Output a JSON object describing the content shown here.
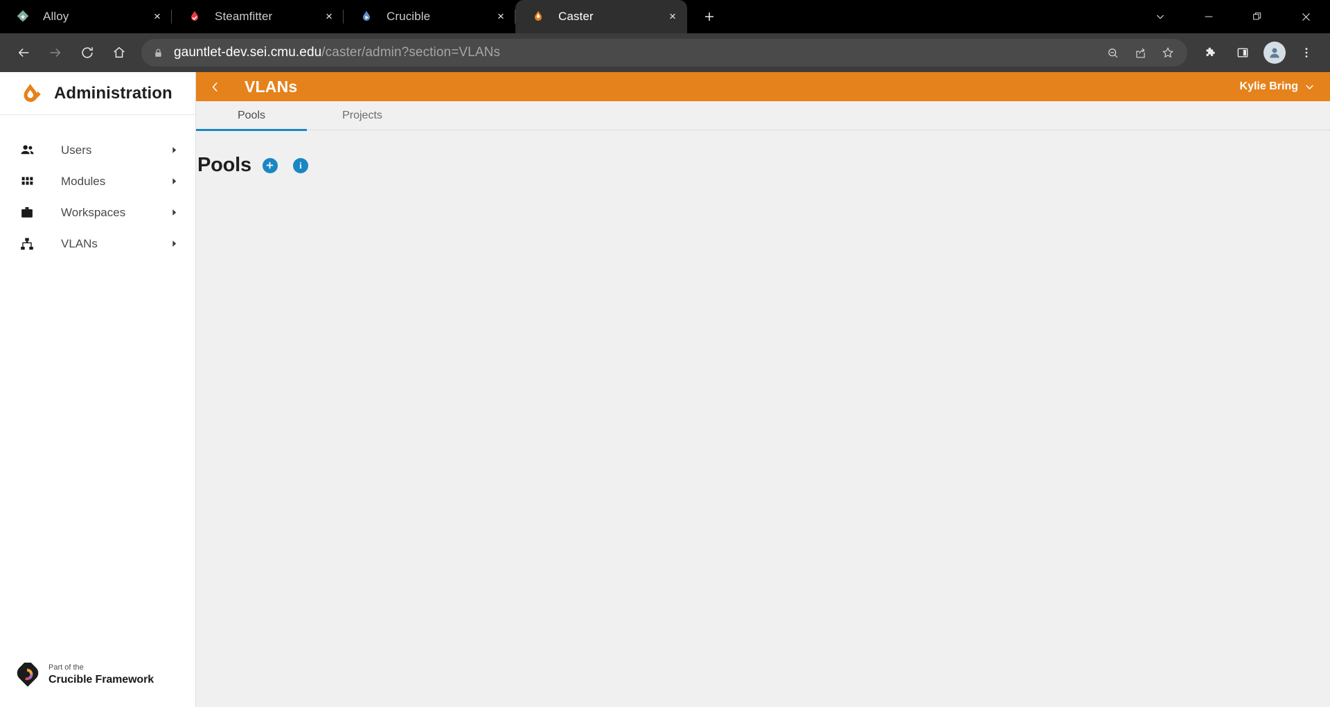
{
  "browser": {
    "tabs": [
      {
        "title": "Alloy",
        "favicon": "alloy-droplet-icon",
        "active": false,
        "close_label": "×"
      },
      {
        "title": "Steamfitter",
        "favicon": "steamfitter-droplet-icon",
        "active": false,
        "close_label": "×"
      },
      {
        "title": "Crucible",
        "favicon": "crucible-droplet-icon",
        "active": false,
        "close_label": "×"
      },
      {
        "title": "Caster",
        "favicon": "caster-droplet-icon",
        "active": true,
        "close_label": "×"
      }
    ],
    "new_tab_label": "+",
    "window_controls": [
      {
        "name": "tab-search-button",
        "glyph": "⌄"
      },
      {
        "name": "minimize-button",
        "glyph": "—"
      },
      {
        "name": "maximize-button",
        "glyph": "❐"
      },
      {
        "name": "close-window-button",
        "glyph": "✕"
      }
    ],
    "nav_buttons": [
      {
        "name": "back-button",
        "glyph": "←",
        "enabled": true
      },
      {
        "name": "forward-button",
        "glyph": "→",
        "enabled": false
      },
      {
        "name": "reload-button",
        "glyph": "↻",
        "enabled": true
      },
      {
        "name": "home-button",
        "glyph": "⌂",
        "enabled": true
      }
    ],
    "omnibox": {
      "security_icon": "lock-icon",
      "url_host": "gauntlet-dev.sei.cmu.edu",
      "url_path": "/caster/admin?section=VLANs",
      "actions": [
        {
          "name": "zoom-out-icon",
          "glyph": "⊖"
        },
        {
          "name": "share-icon",
          "glyph": "➦"
        },
        {
          "name": "bookmark-star-icon",
          "glyph": "☆"
        }
      ]
    },
    "toolbar_right": [
      {
        "name": "extensions-icon",
        "glyph": "❖"
      },
      {
        "name": "side-panel-icon",
        "glyph": "▣"
      },
      {
        "name": "profile-avatar",
        "glyph": "●"
      },
      {
        "name": "chrome-menu-icon",
        "glyph": "⋮"
      }
    ]
  },
  "sidebar": {
    "brand": {
      "logo": "caster-droplet-logo",
      "title": "Administration"
    },
    "items": [
      {
        "label": "Users",
        "icon": "people-icon",
        "chevron": "▸"
      },
      {
        "label": "Modules",
        "icon": "grid-icon",
        "chevron": "▸"
      },
      {
        "label": "Workspaces",
        "icon": "briefcase-icon",
        "chevron": "▸"
      },
      {
        "label": "VLANs",
        "icon": "network-icon",
        "chevron": "▸"
      }
    ],
    "footer": {
      "logo": "crucible-c-logo",
      "line1": "Part of the",
      "line2": "Crucible Framework"
    }
  },
  "app": {
    "header": {
      "back_icon": "chevron-left-icon",
      "title": "VLANs",
      "user_name": "Kylie Bring",
      "user_chevron": "⌄",
      "background_color": "#e5821c"
    },
    "tabs": [
      {
        "label": "Pools",
        "active": true
      },
      {
        "label": "Projects",
        "active": false
      }
    ],
    "section": {
      "title": "Pools",
      "add_button": {
        "name": "add-pool-button",
        "glyph": "+"
      },
      "info_button": {
        "name": "info-button",
        "glyph": "i"
      },
      "accent_color": "#1a87c4"
    }
  }
}
